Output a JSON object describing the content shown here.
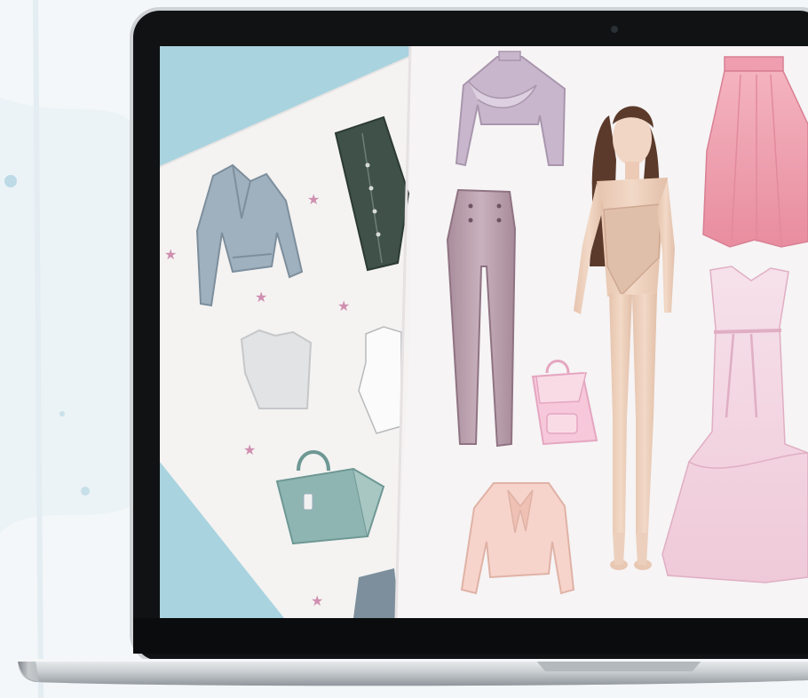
{
  "scene": {
    "subject": "laptop-with-paper-doll-printables",
    "colors": {
      "background": "#f3f7f9",
      "bezel": "#101214",
      "body_silver": "#cfd3d6",
      "screen_blue": "#a9d3df",
      "paper": "#f6f4f5",
      "rose": "#efa5b4",
      "blush": "#f2d7e2",
      "lilac": "#c8b7cc",
      "mauve": "#b59aa8",
      "teal": "#8fb5b2",
      "slate": "#9fb0be",
      "forest": "#3f5149",
      "skin": "#edd1bc",
      "hair": "#5b3a2b",
      "peach": "#f6d4cb",
      "star": "#cf8fb0"
    },
    "objects": [
      "laptop",
      "back-sheet",
      "front-sheet",
      "lilac-ruffle-top",
      "mauve-pants",
      "pink-backpack",
      "peach-bow-blouse",
      "paper-doll",
      "rose-skirt",
      "blush-gown",
      "grey-moto-jacket",
      "green-button-skirt",
      "grey-crop-top",
      "teal-handbag",
      "outline-shirt",
      "star-stickers"
    ]
  }
}
